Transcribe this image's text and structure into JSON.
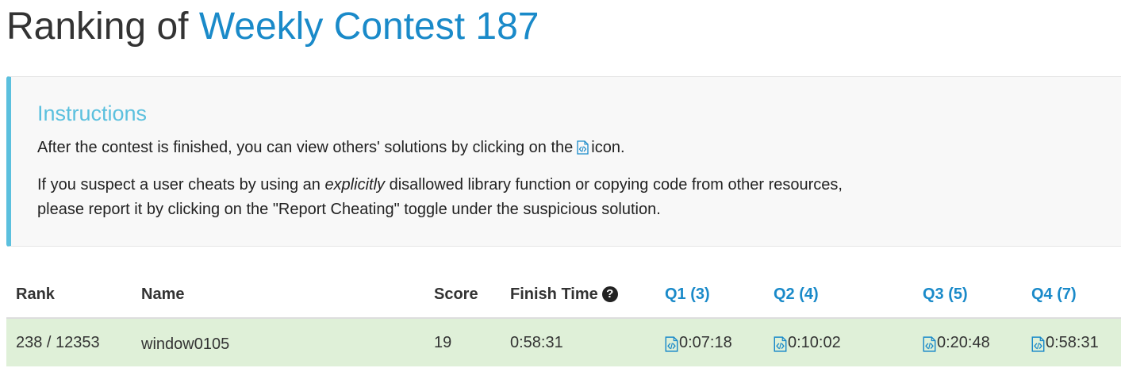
{
  "header": {
    "title_prefix": "Ranking of",
    "contest_name": "Weekly Contest 187"
  },
  "instructions": {
    "heading": "Instructions",
    "line1_before_icon": "After the contest is finished, you can view others' solutions by clicking on the",
    "line1_after_icon": "icon.",
    "line2_before_emphasis": "If you suspect a user cheats by using an",
    "line2_emphasis": "explicitly",
    "line2_after_emphasis": "disallowed library function or copying code from other resources,",
    "line3": "please report it by clicking on the \"Report Cheating\" toggle under the suspicious solution."
  },
  "table": {
    "columns": {
      "rank": "Rank",
      "name": "Name",
      "score": "Score",
      "finish_time": "Finish Time",
      "q1": "Q1 (3)",
      "q2": "Q2 (4)",
      "q3": "Q3 (5)",
      "q4": "Q4 (7)"
    },
    "rows": [
      {
        "rank": "238 / 12353",
        "name": "window0105",
        "score": "19",
        "finish_time": "0:58:31",
        "q1": "0:07:18",
        "q2": "0:10:02",
        "q3": "0:20:48",
        "q4": "0:58:31"
      }
    ]
  },
  "colors": {
    "link_blue": "#1a8ac9",
    "info_blue": "#5bc0de",
    "row_success_green": "#dff0d8"
  },
  "icons": {
    "solution": "code-file-icon",
    "help": "question-circle-icon"
  }
}
